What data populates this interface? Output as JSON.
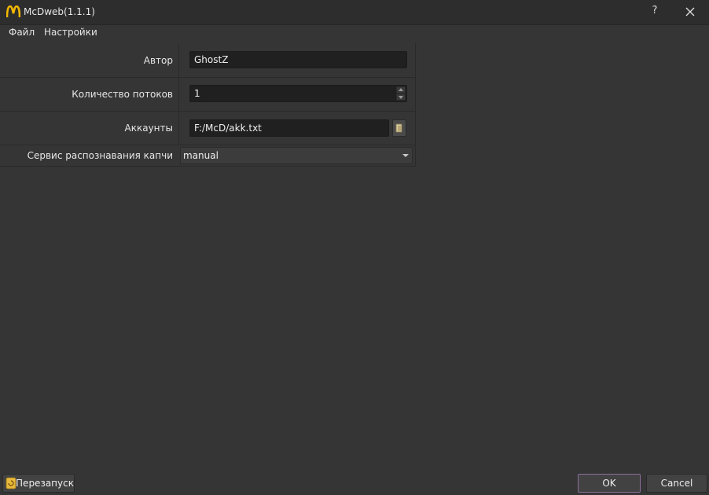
{
  "window": {
    "title": "McDweb(1.1.1)",
    "help_glyph": "?",
    "icons": [
      "mcdonalds-logo-icon",
      "close-icon"
    ]
  },
  "menu": {
    "file": "Файл",
    "settings": "Настройки"
  },
  "form": {
    "author": {
      "label": "Автор",
      "value": "GhostZ"
    },
    "threads": {
      "label": "Количество потоков",
      "value": "1"
    },
    "accounts": {
      "label": "Аккаунты",
      "value": "F:/McD/akk.txt"
    },
    "captcha": {
      "label": "Сервис распознавания капчи",
      "selected": "manual"
    }
  },
  "footer": {
    "restart_label": "Перезапуск",
    "ok_label": "OK",
    "cancel_label": "Cancel"
  },
  "colors": {
    "background": "#353535",
    "input_background": "#202020",
    "ok_border": "#8b6f9b",
    "logo_yellow": "#f2b705"
  }
}
